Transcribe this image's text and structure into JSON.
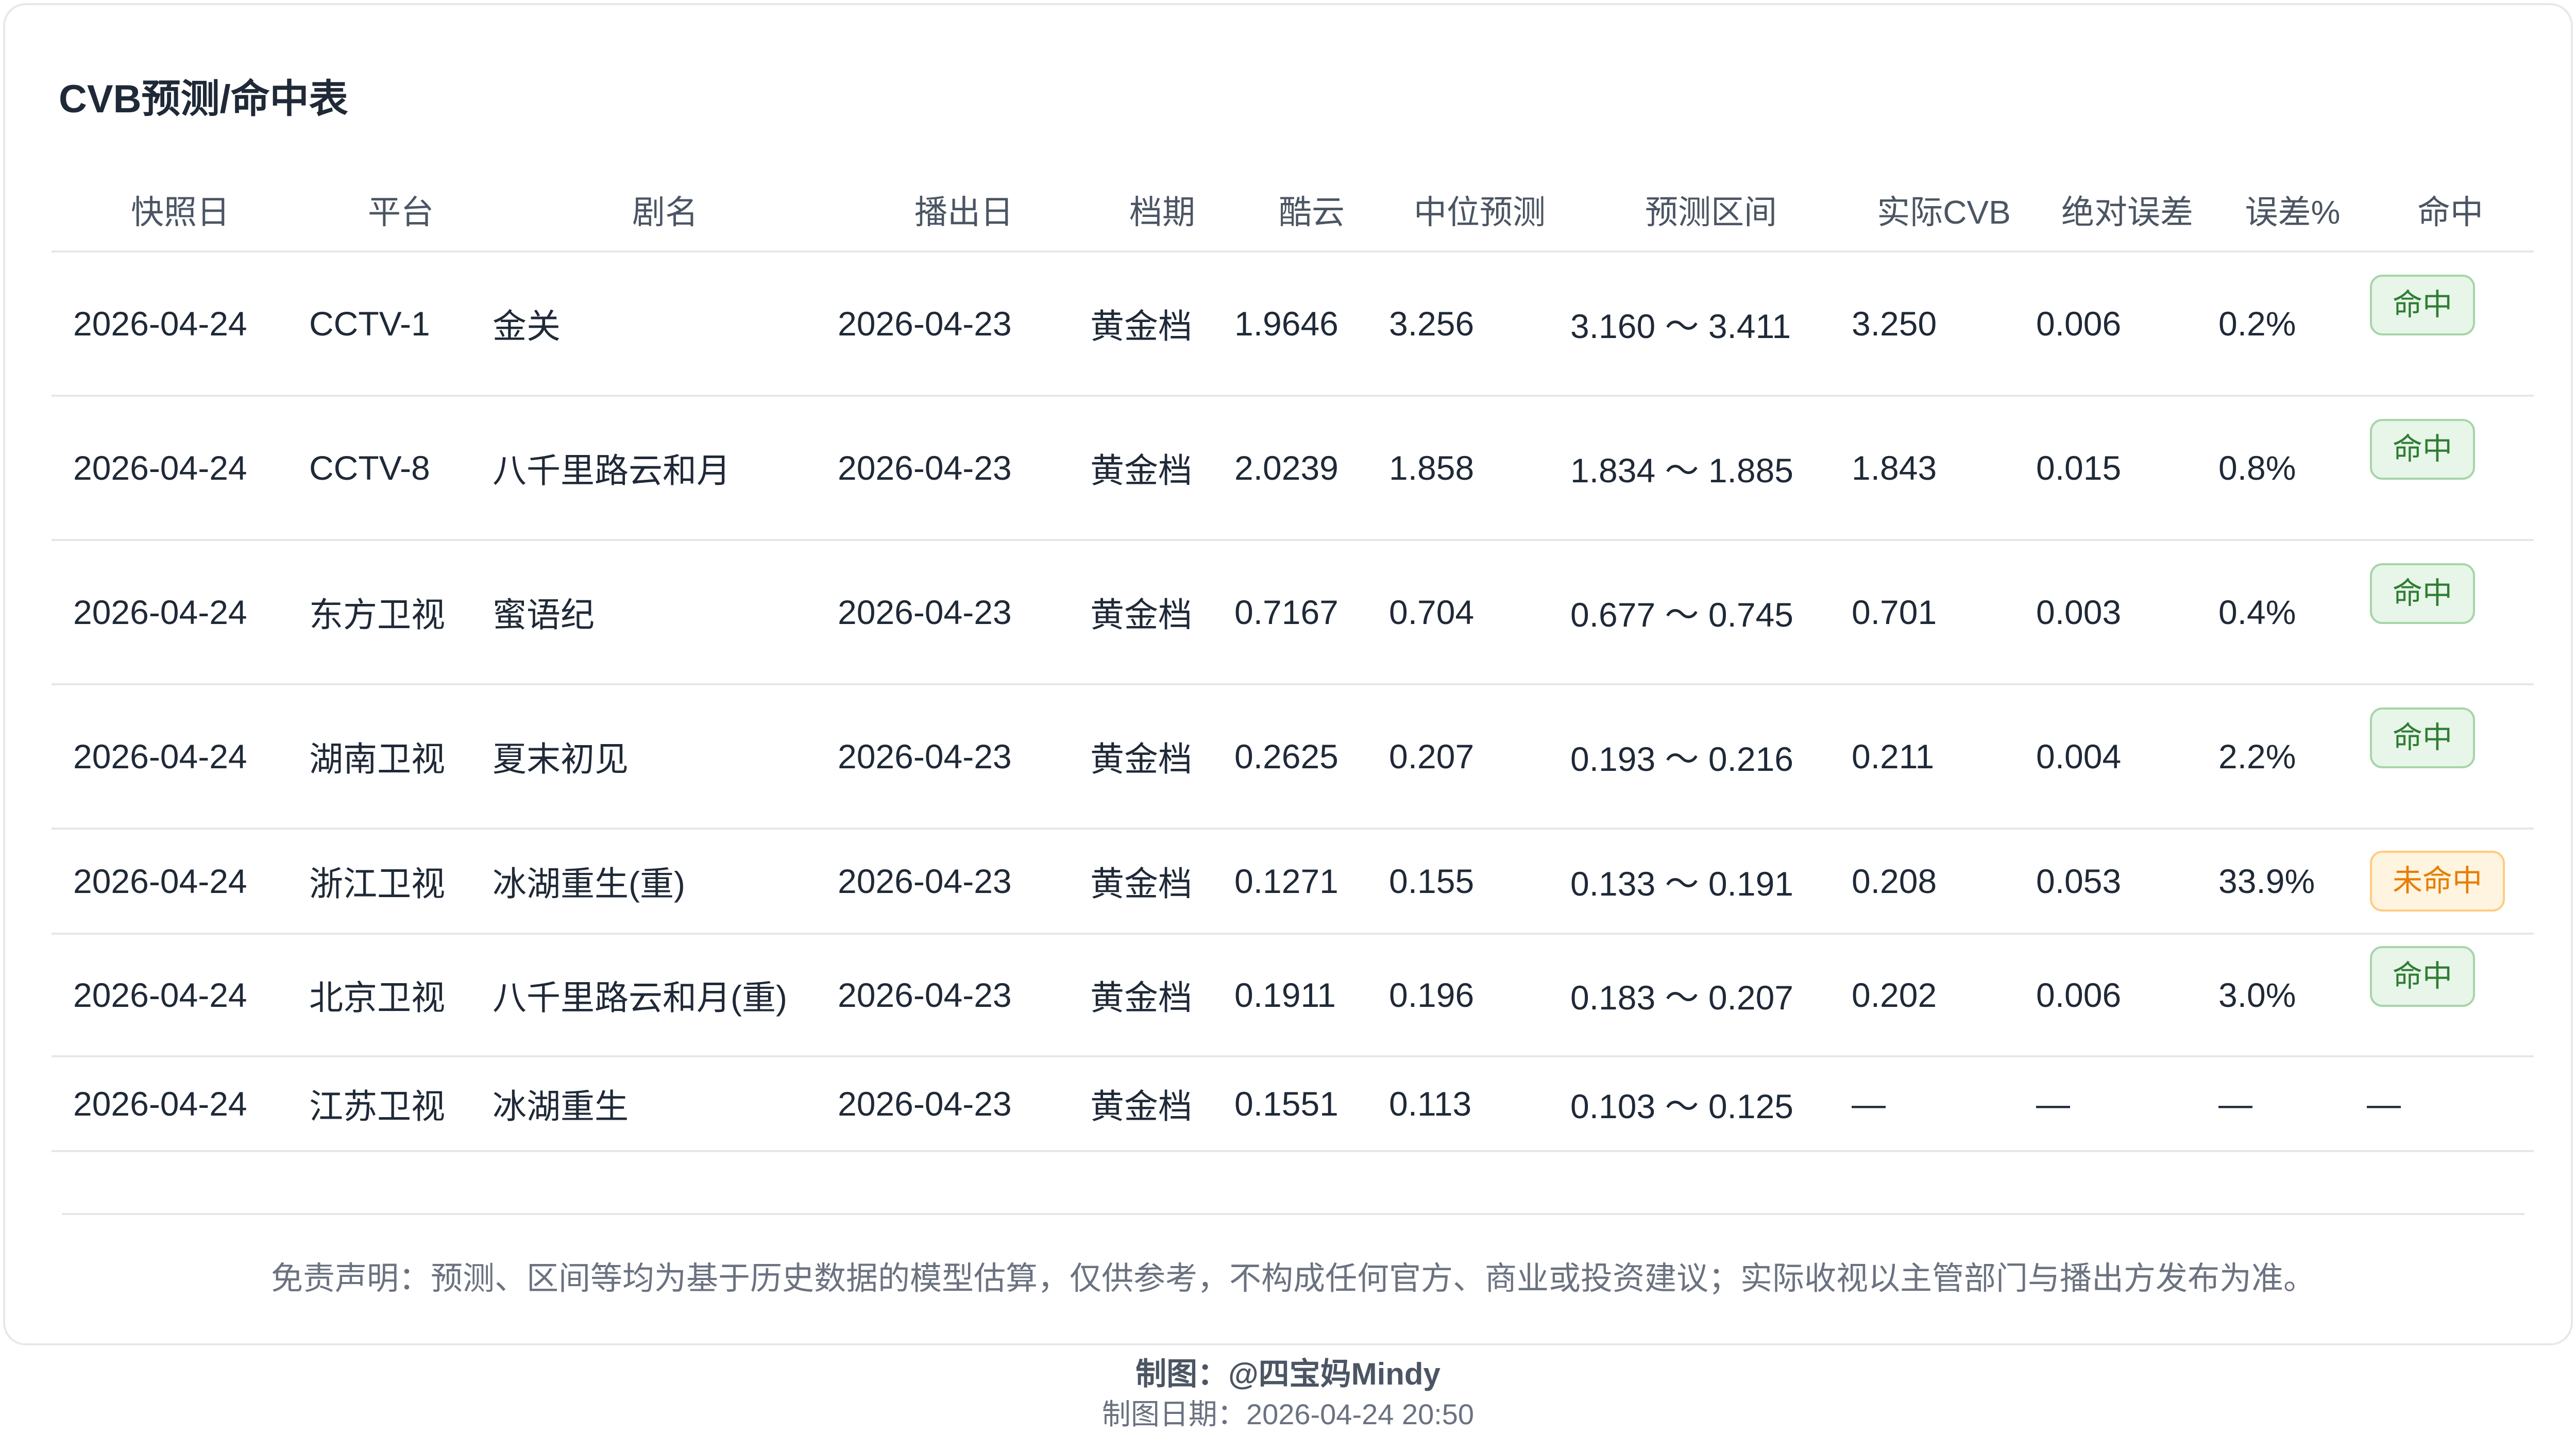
{
  "title": "CVB预测/命中表",
  "columns": [
    "快照日",
    "平台",
    "剧名",
    "播出日",
    "档期",
    "酷云",
    "中位预测",
    "预测区间",
    "实际CVB",
    "绝对误差",
    "误差%",
    "命中"
  ],
  "rows": [
    {
      "snapshot": "2026-04-24",
      "platform": "CCTV-1",
      "drama": "金关",
      "air_date": "2026-04-23",
      "slot": "黄金档",
      "kuyun": "1.9646",
      "median": "3.256",
      "range": "3.160 ～ 3.411",
      "actual": "3.250",
      "abs_err": "0.006",
      "err_pct": "0.2%",
      "hit": "命中"
    },
    {
      "snapshot": "2026-04-24",
      "platform": "CCTV-8",
      "drama": "八千里路云和月",
      "air_date": "2026-04-23",
      "slot": "黄金档",
      "kuyun": "2.0239",
      "median": "1.858",
      "range": "1.834 ～ 1.885",
      "actual": "1.843",
      "abs_err": "0.015",
      "err_pct": "0.8%",
      "hit": "命中"
    },
    {
      "snapshot": "2026-04-24",
      "platform": "东方卫视",
      "drama": "蜜语纪",
      "air_date": "2026-04-23",
      "slot": "黄金档",
      "kuyun": "0.7167",
      "median": "0.704",
      "range": "0.677 ～ 0.745",
      "actual": "0.701",
      "abs_err": "0.003",
      "err_pct": "0.4%",
      "hit": "命中"
    },
    {
      "snapshot": "2026-04-24",
      "platform": "湖南卫视",
      "drama": "夏末初见",
      "air_date": "2026-04-23",
      "slot": "黄金档",
      "kuyun": "0.2625",
      "median": "0.207",
      "range": "0.193 ～ 0.216",
      "actual": "0.211",
      "abs_err": "0.004",
      "err_pct": "2.2%",
      "hit": "命中"
    },
    {
      "snapshot": "2026-04-24",
      "platform": "浙江卫视",
      "drama": "冰湖重生(重)",
      "air_date": "2026-04-23",
      "slot": "黄金档",
      "kuyun": "0.1271",
      "median": "0.155",
      "range": "0.133 ～ 0.191",
      "actual": "0.208",
      "abs_err": "0.053",
      "err_pct": "33.9%",
      "hit": "未命中"
    },
    {
      "snapshot": "2026-04-24",
      "platform": "北京卫视",
      "drama": "八千里路云和月(重)",
      "air_date": "2026-04-23",
      "slot": "黄金档",
      "kuyun": "0.1911",
      "median": "0.196",
      "range": "0.183 ～ 0.207",
      "actual": "0.202",
      "abs_err": "0.006",
      "err_pct": "3.0%",
      "hit": "命中"
    },
    {
      "snapshot": "2026-04-24",
      "platform": "江苏卫视",
      "drama": "冰湖重生",
      "air_date": "2026-04-23",
      "slot": "黄金档",
      "kuyun": "0.1551",
      "median": "0.113",
      "range": "0.103 ～ 0.125",
      "actual": "—",
      "abs_err": "—",
      "err_pct": "—",
      "hit": "—"
    }
  ],
  "disclaimer": "免责声明：预测、区间等均为基于历史数据的模型估算，仅供参考，不构成任何官方、商业或投资建议；实际收视以主管部门与播出方发布为准。",
  "footer": {
    "author": "制图：@四宝妈Mindy",
    "date": "制图日期：2026-04-24 20:50"
  },
  "colors": {
    "hit_bg": "#e8f5e9",
    "hit_text": "#2e7d32",
    "miss_bg": "#fff4e0",
    "miss_text": "#e67e00"
  }
}
